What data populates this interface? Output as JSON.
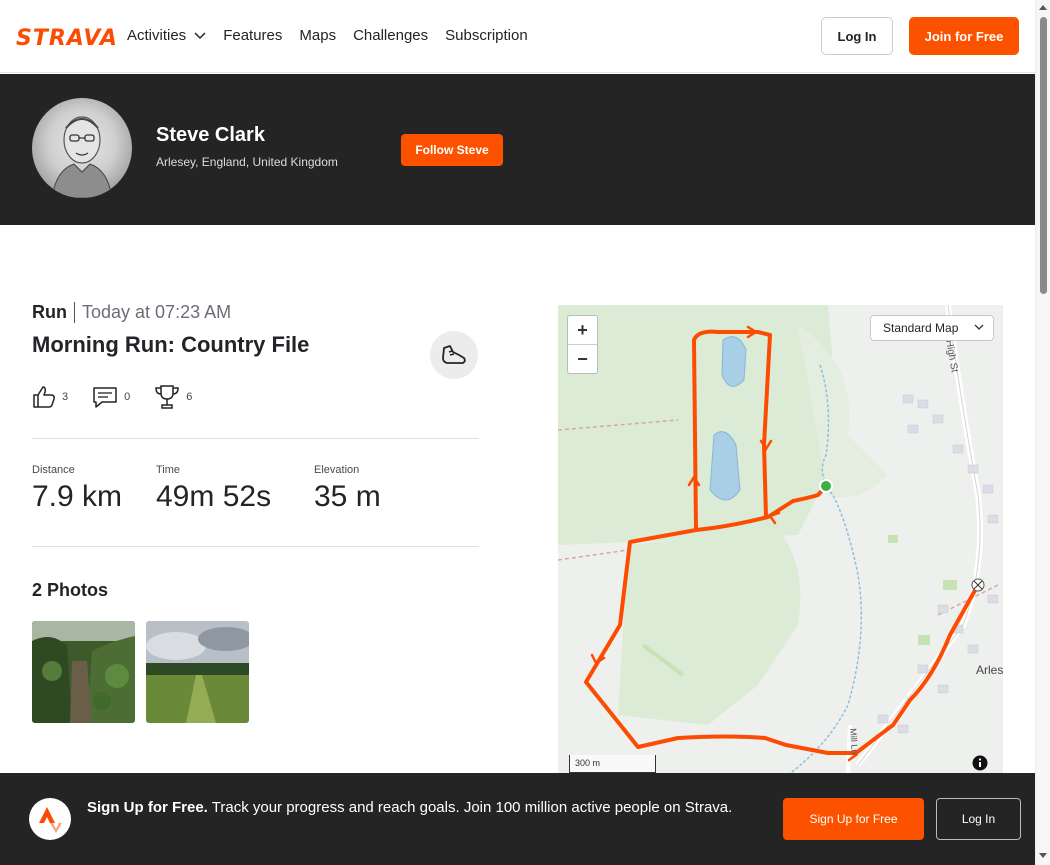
{
  "nav": {
    "logo": "STRAVA",
    "links": [
      "Activities",
      "Features",
      "Maps",
      "Challenges",
      "Subscription"
    ],
    "login": "Log In",
    "join": "Join for Free"
  },
  "athlete": {
    "name": "Steve Clark",
    "location": "Arlesey, England, United Kingdom",
    "follow": "Follow Steve"
  },
  "activity": {
    "type": "Run",
    "date": "Today at 07:23 AM",
    "title": "Morning Run: Country File",
    "kudos": "3",
    "comments": "0",
    "achievements": "6",
    "stats": [
      {
        "label": "Distance",
        "value": "7.9 km"
      },
      {
        "label": "Time",
        "value": "49m 52s"
      },
      {
        "label": "Elevation",
        "value": "35 m"
      }
    ],
    "photos_title": "2 Photos"
  },
  "map": {
    "style": "Standard Map",
    "scale": "300 m",
    "labels": {
      "street": "High St",
      "town": "Arles",
      "lane": "Mill Ln"
    }
  },
  "signup": {
    "headline": "Sign Up for Free.",
    "body": "Track your progress and reach goals. Join 100 million active people on Strava.",
    "cta": "Sign Up for Free",
    "login": "Log In"
  },
  "colors": {
    "brand": "#fc5200",
    "route": "#fc4c02",
    "header_bg": "#242424"
  }
}
